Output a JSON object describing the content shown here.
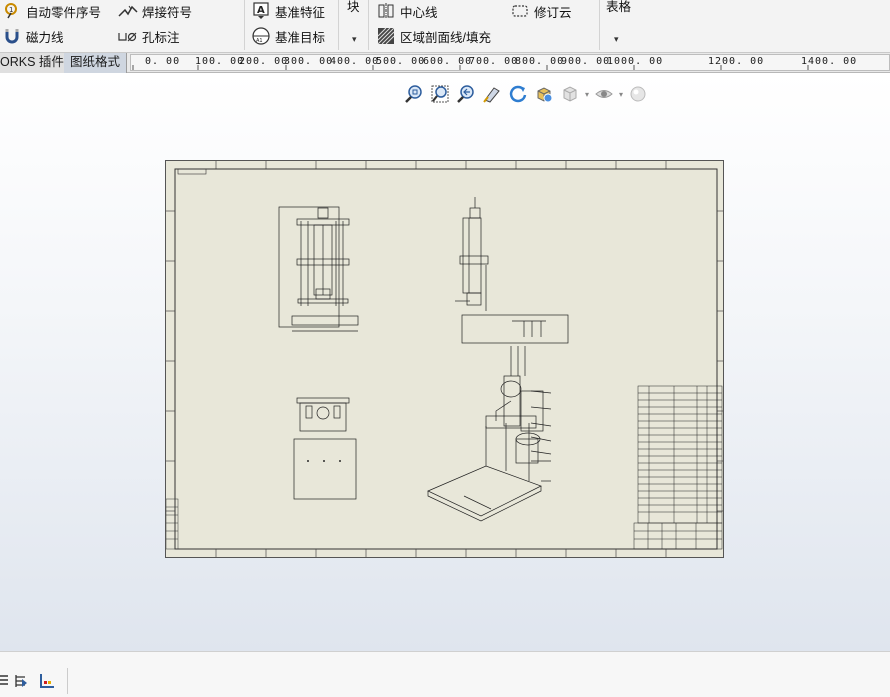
{
  "ribbon": {
    "auto_balloon": "自动零件序号",
    "weld_symbol": "焊接符号",
    "datum_feature": "基准特征",
    "block": "块",
    "center_line": "中心线",
    "revision_cloud": "修订云",
    "table": "表格",
    "magnetic_line": "磁力线",
    "hole_callout": "孔标注",
    "datum_target": "基准目标",
    "area_hatch": "区域剖面线/填充"
  },
  "tabs": [
    {
      "label": "ORKS 插件"
    },
    {
      "label": "图纸格式"
    }
  ],
  "ruler": {
    "ticks": [
      "0. 00",
      "100. 00",
      "200. 00",
      "300. 00",
      "400. 00",
      "500. 00",
      "600. 00",
      "700. 00",
      "800. 00",
      "900. 00",
      "1000. 00",
      "1200. 00",
      "1400. 00"
    ]
  },
  "headsup_icons": [
    "zoom-to-fit-icon",
    "zoom-to-area-icon",
    "previous-view-icon",
    "section-view-icon",
    "rotate-view-icon",
    "view-orientation-icon",
    "display-style-icon",
    "hide-show-icon",
    "edit-appearance-icon"
  ],
  "colors": {
    "sheet": "#e8e7d9",
    "ribbon": "#f3f3f3",
    "accent": "#3a6fb0"
  }
}
